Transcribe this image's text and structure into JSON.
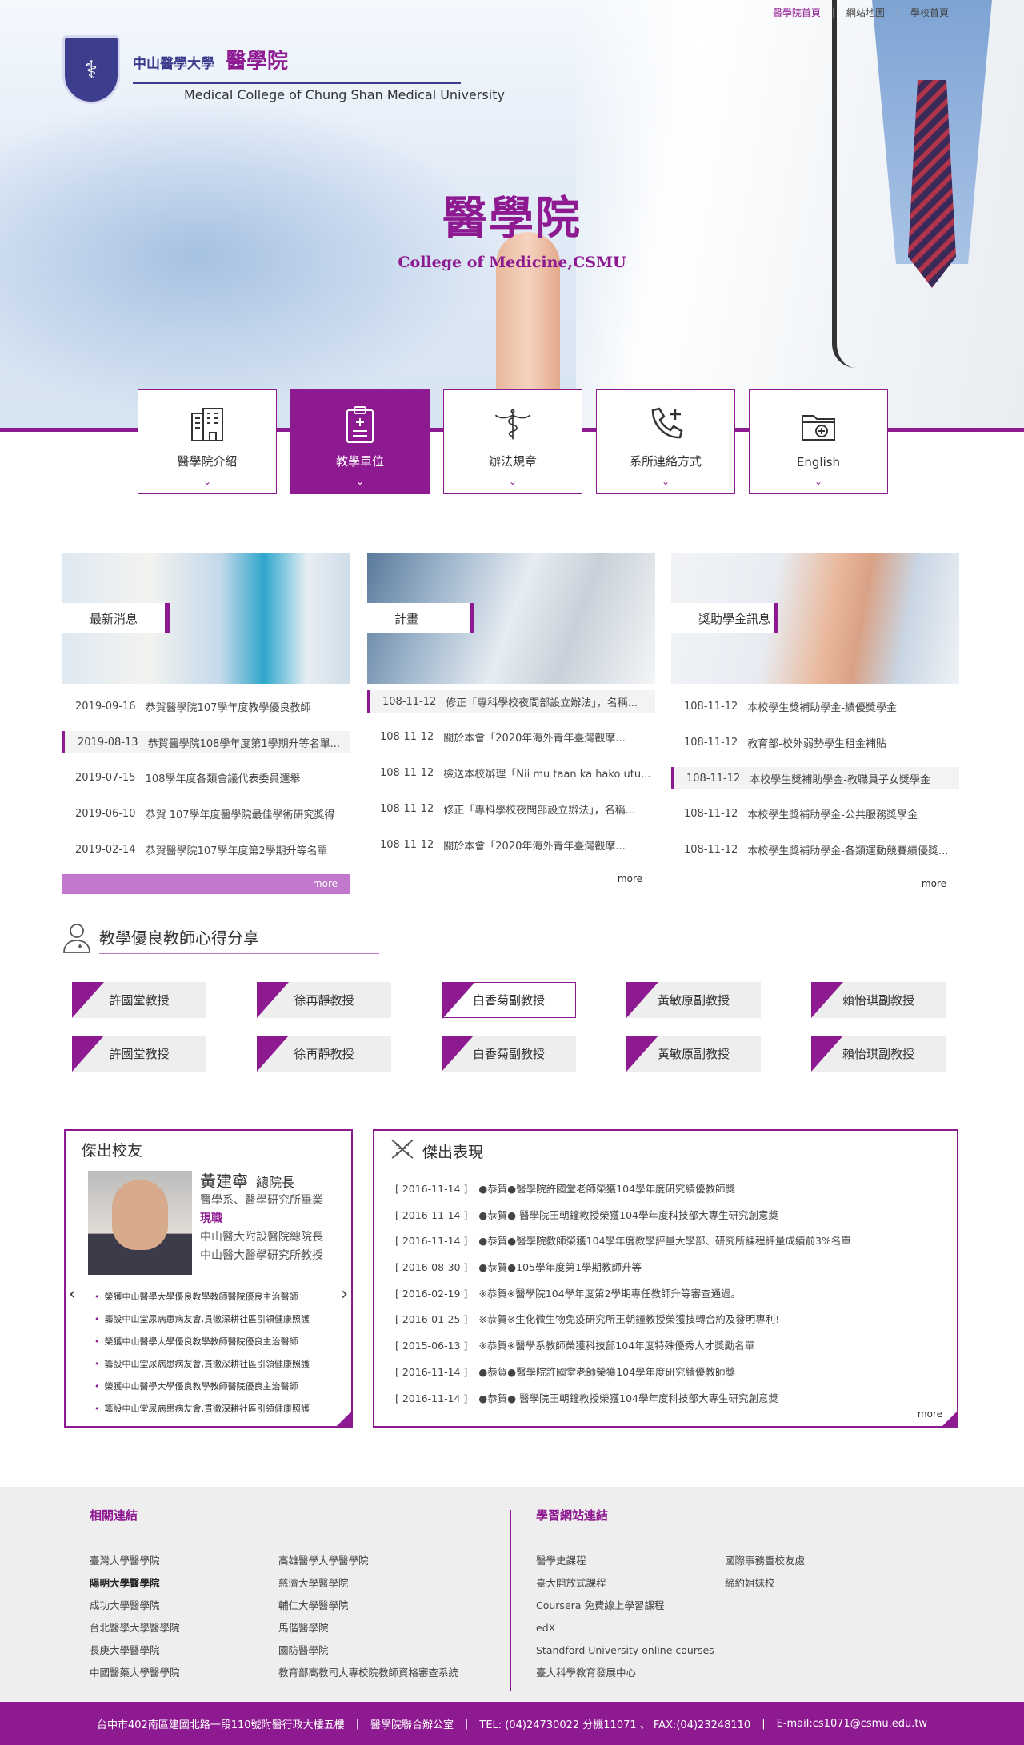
{
  "topbar": [
    "醫學院首頁",
    "網站地圖",
    "學校首頁"
  ],
  "logo": {
    "cn": "中山醫學大學",
    "cn_big": "醫學院",
    "en": "Medical College of Chung Shan Medical University"
  },
  "hero": {
    "title": "醫學院",
    "subtitle": "College of Medicine,CSMU"
  },
  "nav": [
    {
      "label": "醫學院介紹",
      "icon": "building-icon"
    },
    {
      "label": "教學單位",
      "icon": "clipboard-icon"
    },
    {
      "label": "辦法規章",
      "icon": "caduceus-icon"
    },
    {
      "label": "系所連絡方式",
      "icon": "phone-icon"
    },
    {
      "label": "English",
      "icon": "folder-plus-icon"
    }
  ],
  "news": {
    "label": "最新消息",
    "items": [
      {
        "date": "2019-09-16",
        "title": "恭賀醫學院107學年度教學優良教師"
      },
      {
        "date": "2019-08-13",
        "title": "恭賀醫學院108學年度第1學期升等名單..."
      },
      {
        "date": "2019-07-15",
        "title": "108學年度各類會議代表委員選舉"
      },
      {
        "date": "2019-06-10",
        "title": "恭賀 107學年度醫學院最佳學術研究獎得"
      },
      {
        "date": "2019-02-14",
        "title": "恭賀醫學院107學年度第2學期升等名單"
      }
    ],
    "more": "more"
  },
  "plans": {
    "label": "計畫",
    "items": [
      {
        "date": "108-11-12",
        "title": "修正「專科學校夜間部設立辦法」，名稱..."
      },
      {
        "date": "108-11-12",
        "title": "關於本會「2020年海外青年臺灣觀摩..."
      },
      {
        "date": "108-11-12",
        "title": "檢送本校辦理「Nii mu taan ka hako utu..."
      },
      {
        "date": "108-11-12",
        "title": "修正「專科學校夜間部設立辦法」，名稱..."
      },
      {
        "date": "108-11-12",
        "title": "關於本會「2020年海外青年臺灣觀摩..."
      }
    ],
    "more": "more"
  },
  "scholar": {
    "label": "獎助學金訊息",
    "items": [
      {
        "date": "108-11-12",
        "title": "本校學生獎補助學金-績優獎學金"
      },
      {
        "date": "108-11-12",
        "title": "教育部-校外弱勢學生租金補貼"
      },
      {
        "date": "108-11-12",
        "title": "本校學生獎補助學金-教職員子女獎學金"
      },
      {
        "date": "108-11-12",
        "title": "本校學生獎補助學金-公共服務獎學金"
      },
      {
        "date": "108-11-12",
        "title": "本校學生獎補助學金-各類運動競賽績優獎..."
      }
    ],
    "more": "more"
  },
  "teachers": {
    "title": "教學優良教師心得分享",
    "row1": [
      "許國堂教授",
      "徐再靜教授",
      "白香菊副教授",
      "黃敏原副教授",
      "賴怡琪副教授"
    ],
    "row2": [
      "許國堂教授",
      "徐再靜教授",
      "白香菊副教授",
      "黃敏原副教授",
      "賴怡琪副教授"
    ]
  },
  "alumni": {
    "title": "傑出校友",
    "name": "黃建寧",
    "role": "總院長",
    "edu": "醫學系、醫學研究所畢業",
    "cur_label": "現職",
    "cur1": "中山醫大附設醫院總院長",
    "cur2": "中山醫大醫學研究所教授",
    "list": [
      "榮獲中山醫學大學優良教學教師醫院優良主治醫師",
      "籌設中山堂尿病患病友會,貫徹深耕社區引領健康照護",
      "榮獲中山醫學大學優良教學教師醫院優良主治醫師",
      "籌設中山堂尿病患病友會,貫徹深耕社區引領健康照護",
      "榮獲中山醫學大學優良教學教師醫院優良主治醫師",
      "籌設中山堂尿病患病友會,貫徹深耕社區引領健康照護"
    ]
  },
  "perf": {
    "title": "傑出表現",
    "items": [
      {
        "date": "[ 2016-11-14 ]",
        "text": "●恭賀●醫學院許國堂老師榮獲104學年度研究績優教師獎"
      },
      {
        "date": "[ 2016-11-14 ]",
        "text": "●恭賀● 醫學院王朝鐘教授榮獲104學年度科技部大專生研究創意獎"
      },
      {
        "date": "[ 2016-11-14 ]",
        "text": "●恭賀●醫學院教師榮獲104學年度教學評量大學部、研究所課程評量成績前3%名單"
      },
      {
        "date": "[ 2016-08-30 ]",
        "text": "●恭賀●105學年度第1學期教師升等"
      },
      {
        "date": "[ 2016-02-19 ]",
        "text": "※恭賀※醫學院104學年度第2學期專任教師升等審查通過。"
      },
      {
        "date": "[ 2016-01-25 ]",
        "text": "※恭賀※生化微生物免疫研究所王朝鐘教授榮獲技轉合約及發明專利!"
      },
      {
        "date": "[ 2015-06-13 ]",
        "text": "※恭賀※醫學系教師榮獲科技部104年度特殊優秀人才獎勵名單"
      },
      {
        "date": "[ 2016-11-14 ]",
        "text": "●恭賀●醫學院許國堂老師榮獲104學年度研究績優教師獎"
      },
      {
        "date": "[ 2016-11-14 ]",
        "text": "●恭賀● 醫學院王朝鐘教授榮獲104學年度科技部大專生研究創意獎"
      }
    ],
    "more": "more"
  },
  "related": {
    "title": "相關連結",
    "items": [
      "臺灣大學醫學院",
      "高雄醫學大學醫學院",
      "陽明大學醫學院",
      "慈濟大學醫學院",
      "成功大學醫學院",
      "輔仁大學醫學院",
      "台北醫學大學醫學院",
      "馬偕醫學院",
      "長庚大學醫學院",
      "國防醫學院",
      "中國醫藥大學醫學院",
      "教育部高教司大專校院教師資格審查系統"
    ]
  },
  "learning": {
    "title": "學習網站連結",
    "items": [
      "醫學史課程",
      "國際事務暨校友處",
      "臺大開放式課程",
      "締約姐妹校",
      "Coursera 免費線上學習課程",
      "",
      "edX",
      "",
      "Standford University online courses",
      "",
      "臺大科學教育發展中心",
      ""
    ]
  },
  "footer": {
    "address": "台中市402南區建國北路一段110號附醫行政大樓五樓",
    "office": "醫學院聯合辦公室",
    "tel": "TEL: (04)24730022 分機11071 、 FAX:(04)23248110",
    "email": "E-mail:cs1071@csmu.edu.tw"
  },
  "colors": {
    "accent": "#8e1a92",
    "light_accent": "#c178cc"
  }
}
